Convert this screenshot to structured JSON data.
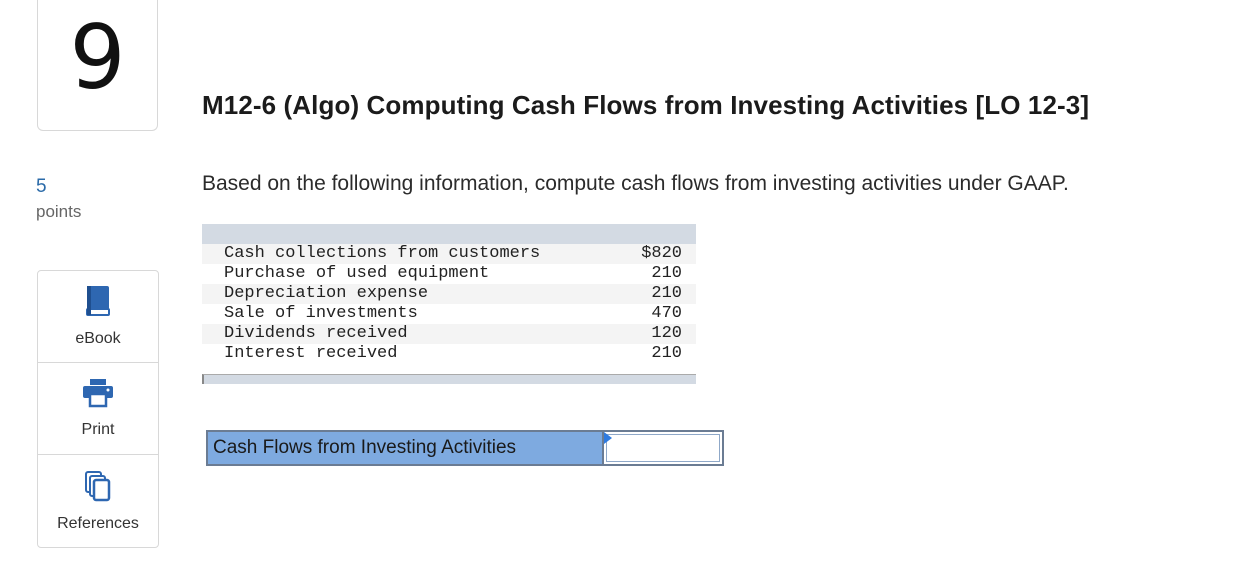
{
  "question": {
    "number": "9",
    "points_value": "5",
    "points_label": "points",
    "title": "M12-6 (Algo) Computing Cash Flows from Investing Activities [LO 12-3]",
    "prompt": "Based on the following information, compute cash flows from investing activities under GAAP."
  },
  "sidebar": {
    "items": [
      {
        "label": "eBook",
        "icon": "book-icon"
      },
      {
        "label": "Print",
        "icon": "printer-icon"
      },
      {
        "label": "References",
        "icon": "copy-icon"
      }
    ]
  },
  "table": {
    "rows": [
      {
        "label": "Cash collections from customers",
        "value": "$820"
      },
      {
        "label": "Purchase of used equipment",
        "value": "210"
      },
      {
        "label": "Depreciation expense",
        "value": "210"
      },
      {
        "label": "Sale of investments",
        "value": "470"
      },
      {
        "label": "Dividends received",
        "value": "120"
      },
      {
        "label": "Interest received",
        "value": "210"
      }
    ]
  },
  "answer": {
    "label": "Cash Flows from Investing Activities",
    "value": ""
  },
  "colors": {
    "points": "#2a6aa8",
    "answer_label_bg": "#7eaae0",
    "table_band": "#d3dae3"
  }
}
